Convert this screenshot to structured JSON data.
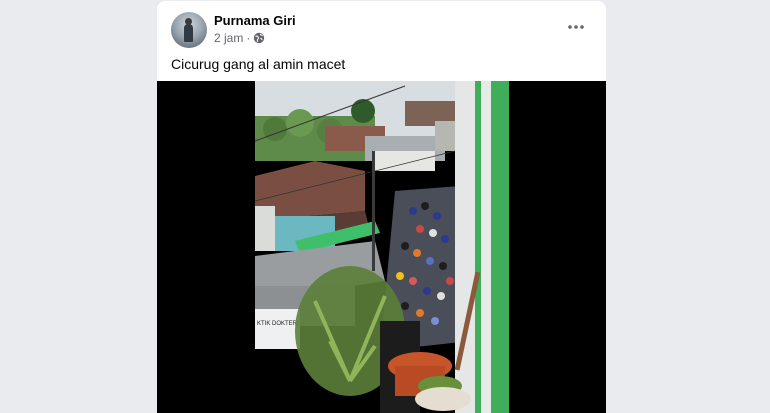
{
  "post": {
    "author": "Purnama Giri",
    "time": "2 jam",
    "separator": "·",
    "caption": "Cicurug gang al amin macet",
    "icons": {
      "avatar": "profile-photo",
      "audience": "globe-icon",
      "menu": "more-horizontal-icon"
    }
  },
  "video_frame_sign": "KTIK DOKTER"
}
